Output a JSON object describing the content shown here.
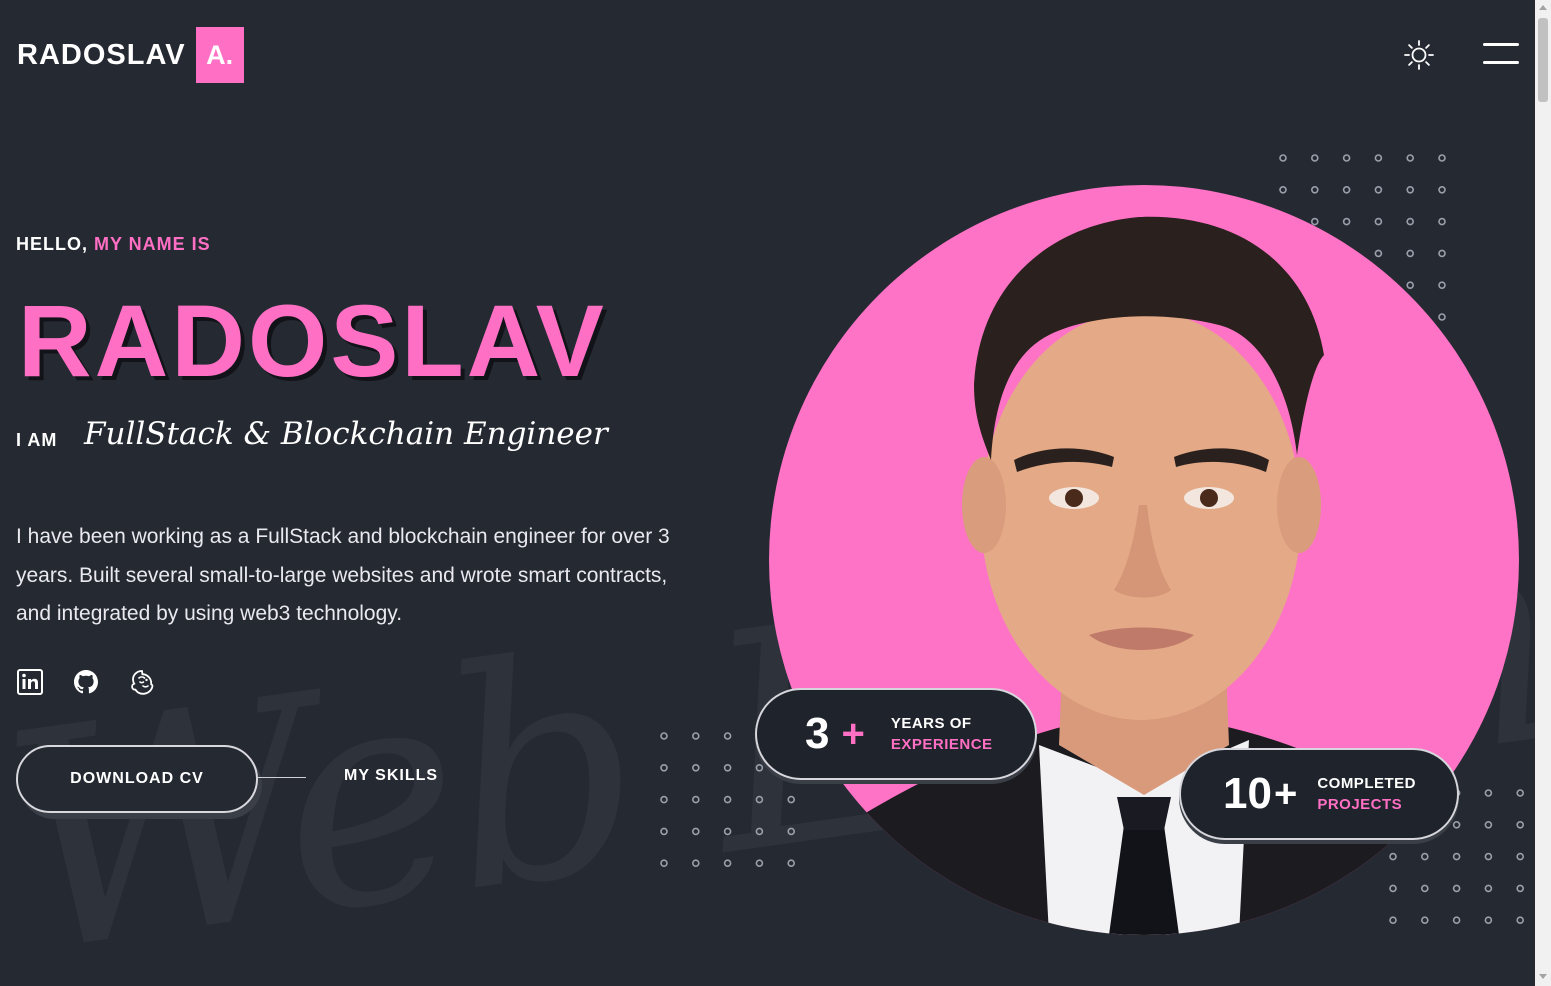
{
  "header": {
    "logo_text": "RADOSLAV",
    "logo_badge": "A.",
    "theme_icon": "sun-icon",
    "menu_icon": "hamburger-menu-icon"
  },
  "hero": {
    "greeting": "HELLO,",
    "greeting_accent": "MY NAME IS",
    "name": "RADOSLAV",
    "i_am": "I AM",
    "role": "FullStack & Blockchain Engineer",
    "intro": "I have been working as a FullStack and blockchain engineer for over 3 years. Built several small-to-large websites and wrote smart contracts, and integrated by using web3 technology.",
    "socials": [
      {
        "icon": "linkedin-icon"
      },
      {
        "icon": "github-icon"
      },
      {
        "icon": "mailchimp-icon"
      }
    ],
    "download_cv": "DOWNLOAD CV",
    "my_skills": "MY SKILLS",
    "watermark": "Web Engineer"
  },
  "stats": [
    {
      "number": "3",
      "plus": "+",
      "line1": "YEARS OF",
      "line2": "EXPERIENCE"
    },
    {
      "number": "10",
      "plus": "+",
      "line1": "COMPLETED",
      "line2": "PROJECTS"
    }
  ],
  "colors": {
    "background": "#252932",
    "accent": "#ff6fc4",
    "portrait_bg": "#ff73c6"
  }
}
